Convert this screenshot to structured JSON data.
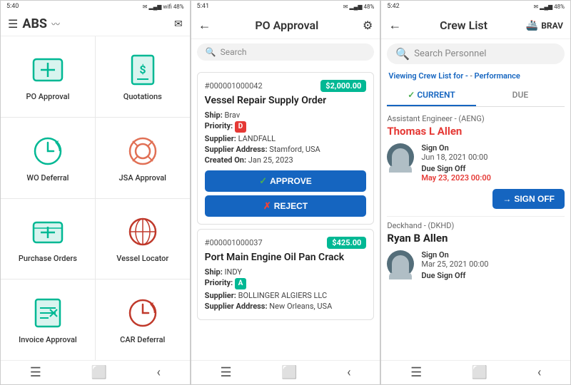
{
  "panels": {
    "panel1": {
      "statusBar": {
        "time": "5:40",
        "battery": "48%"
      },
      "title": "ABS",
      "apps": [
        {
          "id": "po-approval",
          "label": "PO Approval",
          "icon": "money",
          "color": "#00b894"
        },
        {
          "id": "quotations",
          "label": "Quotations",
          "icon": "dollar-note",
          "color": "#00b894"
        },
        {
          "id": "wo-deferral",
          "label": "WO Deferral",
          "icon": "clock-arrow",
          "color": "#00b894"
        },
        {
          "id": "jsa-approval",
          "label": "JSA Approval",
          "icon": "lifebuoy",
          "color": "#e17055"
        },
        {
          "id": "purchase-orders",
          "label": "Purchase Orders",
          "icon": "money2",
          "color": "#00b894"
        },
        {
          "id": "vessel-locator",
          "label": "Vessel Locator",
          "icon": "globe",
          "color": "#c0392b"
        },
        {
          "id": "invoice-approval",
          "label": "Invoice Approval",
          "icon": "calculator",
          "color": "#00b894"
        },
        {
          "id": "car-deferral",
          "label": "CAR Deferral",
          "icon": "clock-arrow2",
          "color": "#c0392b"
        }
      ]
    },
    "panel2": {
      "statusBar": {
        "time": "5:41",
        "battery": "48%"
      },
      "title": "PO Approval",
      "search": {
        "placeholder": "Search"
      },
      "cards": [
        {
          "number": "#000001000042",
          "amount": "$2,000.00",
          "title": "Vessel Repair Supply Order",
          "ship": "Brav",
          "priority": "D",
          "priorityColor": "red",
          "supplier": "LANDFALL",
          "supplierAddress": "Stamford, USA",
          "createdOn": "Jan 25, 2023",
          "showActions": true
        },
        {
          "number": "#000001000037",
          "amount": "$425.00",
          "title": "Port Main Engine Oil Pan Crack",
          "ship": "INDY",
          "priority": "A",
          "priorityColor": "green",
          "supplier": "BOLLINGER ALGIERS LLC",
          "supplierAddress": "New Orleans, USA",
          "createdOn": "",
          "showActions": false
        }
      ],
      "buttons": {
        "approve": "APPROVE",
        "reject": "REJECT"
      }
    },
    "panel3": {
      "statusBar": {
        "time": "5:42",
        "battery": "48%"
      },
      "title": "Crew List",
      "vessel": "BRAV",
      "search": {
        "placeholder": "Search Personnel"
      },
      "viewingLabel": "Viewing Crew List for -",
      "viewingVessel": "Performance",
      "tabs": [
        {
          "id": "current",
          "label": "CURRENT",
          "active": true
        },
        {
          "id": "due",
          "label": "DUE",
          "active": false
        }
      ],
      "crewMembers": [
        {
          "role": "Assistant Engineer - (AENG)",
          "name": "Thomas L Allen",
          "nameHighlighted": true,
          "signOn": "Jun 18, 2021 00:00",
          "dueSignOff": "May 23, 2023 00:00",
          "dueOverdue": true,
          "showSignOff": true
        },
        {
          "role": "Deckhand - (DKHD)",
          "name": "Ryan B Allen",
          "nameHighlighted": false,
          "signOn": "Mar 25, 2021 00:00",
          "dueSignOff": "",
          "dueOverdue": false,
          "showSignOff": false
        }
      ],
      "signOffButton": "SIGN OFF",
      "signOnLabel": "Sign On",
      "dueSignOffLabel": "Due Sign Off"
    }
  }
}
